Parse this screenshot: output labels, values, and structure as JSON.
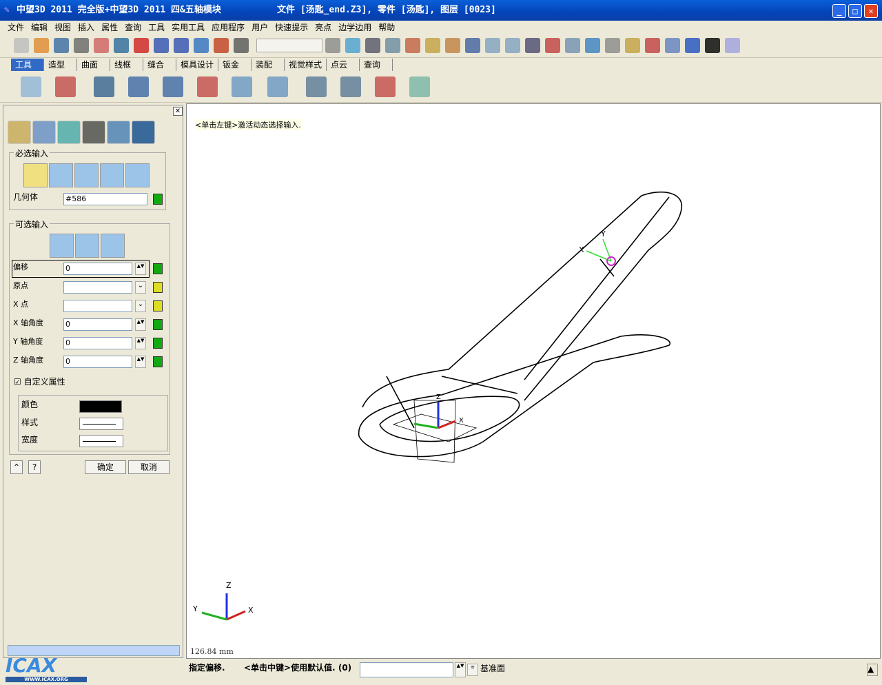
{
  "title": {
    "app": "中望3D 2011 完全版+中望3D 2011 四&五轴模块",
    "file": "文件 [汤匙_end.Z3], 零件 [汤匙], 图层 [0023]"
  },
  "menu": [
    "文件",
    "编辑",
    "视图",
    "插入",
    "属性",
    "查询",
    "工具",
    "实用工具",
    "应用程序",
    "用户",
    "快速提示",
    "亮点",
    "边学边用",
    "帮助"
  ],
  "tabs": [
    "工具",
    "造型",
    "曲面",
    "线框",
    "缝合",
    "模具设计",
    "钣金",
    "装配",
    "视觉样式",
    "点云",
    "查询"
  ],
  "panel": {
    "required_title": "必选输入",
    "geometry_label": "几何体",
    "geometry_value": "#586",
    "optional_title": "可选输入",
    "fields": [
      {
        "label": "偏移",
        "value": "0"
      },
      {
        "label": "原点",
        "value": ""
      },
      {
        "label": "X 点",
        "value": ""
      },
      {
        "label": "X 轴角度",
        "value": "0"
      },
      {
        "label": "Y 轴角度",
        "value": "0"
      },
      {
        "label": "Z 轴角度",
        "value": "0"
      }
    ],
    "custom_attr": "自定义属性",
    "custom_checked": true,
    "color_label": "颜色",
    "color_value": "#000000",
    "style_label": "样式",
    "width_label": "宽度",
    "ok": "确定",
    "cancel": "取消"
  },
  "viewport": {
    "hint": "<单击左键>激活动态选择输入.",
    "scale": "126.84 mm",
    "axes": {
      "x": "X",
      "y": "Y",
      "z": "Z"
    }
  },
  "status": {
    "prompt": "指定偏移.",
    "default_hint": "<单击中键>使用默认值. (0)",
    "input": "",
    "plane": "基准面"
  },
  "logo": {
    "text": "ICAX",
    "url": "WWW.ICAX.ORG"
  }
}
